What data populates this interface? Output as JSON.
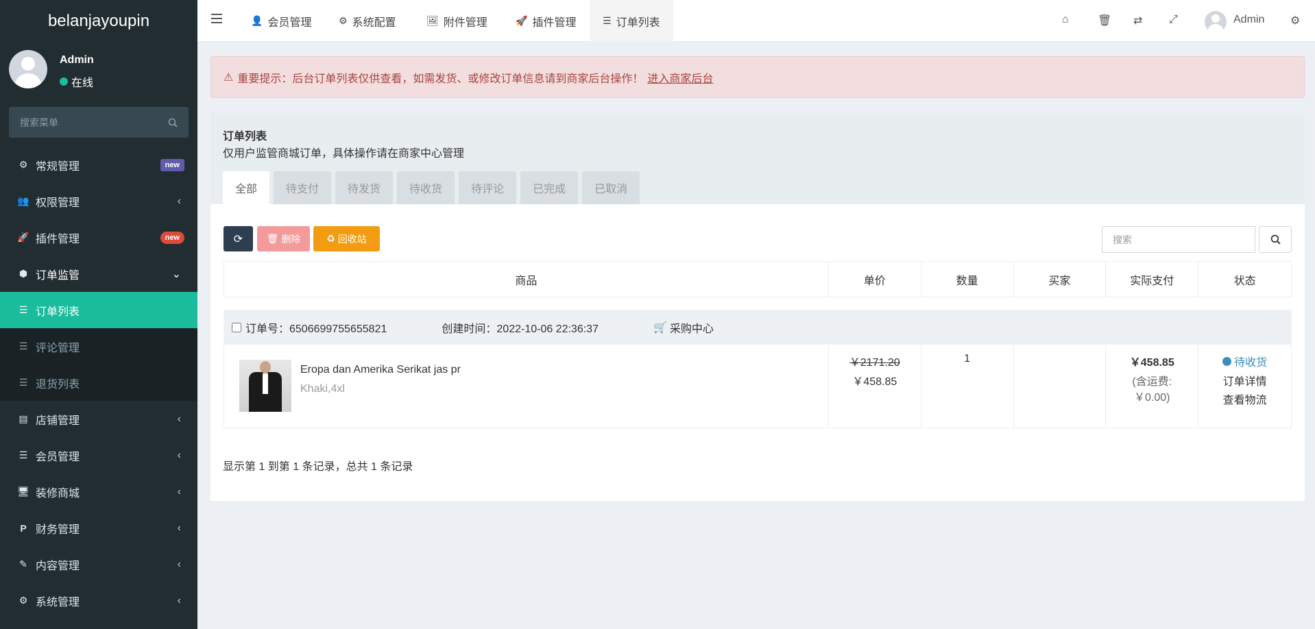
{
  "sidebar": {
    "logo": "belanjayoupin",
    "user": {
      "name": "Admin",
      "status": "在线"
    },
    "search_placeholder": "搜索菜单",
    "items": [
      {
        "label": "常规管理",
        "badge": "new"
      },
      {
        "label": "权限管理"
      },
      {
        "label": "插件管理",
        "badge": "new"
      },
      {
        "label": "订单监管"
      },
      {
        "label": "订单列表"
      },
      {
        "label": "评论管理"
      },
      {
        "label": "退货列表"
      },
      {
        "label": "店铺管理"
      },
      {
        "label": "会员管理"
      },
      {
        "label": "装修商城"
      },
      {
        "label": "财务管理"
      },
      {
        "label": "内容管理"
      },
      {
        "label": "系统管理"
      }
    ]
  },
  "topbar": {
    "tabs": [
      "会员管理",
      "系统配置",
      "附件管理",
      "插件管理",
      "订单列表"
    ],
    "admin_name": "Admin"
  },
  "alert": {
    "text": "重要提示：后台订单列表仅供查看，如需发货、或修改订单信息请到商家后台操作！",
    "link": "进入商家后台"
  },
  "panel": {
    "title": "订单列表",
    "subtitle": "仅用户监管商城订单，具体操作请在商家中心管理",
    "tabs": [
      "全部",
      "待支付",
      "待发货",
      "待收货",
      "待评论",
      "已完成",
      "已取消"
    ]
  },
  "toolbar": {
    "delete_label": "删除",
    "recycle_label": "回收站",
    "search_placeholder": "搜索"
  },
  "table": {
    "headers": [
      "商品",
      "单价",
      "数量",
      "买家",
      "实际支付",
      "状态"
    ]
  },
  "order": {
    "number_label": "订单号：6506699755655821",
    "created_label": "创建时间：2022-10-06 22:36:37",
    "source": "采购中心",
    "product_name": "Eropa dan Amerika Serikat jas pr",
    "product_spec": "Khaki,4xl",
    "price_old": "￥2171.20",
    "price_new": "￥458.85",
    "quantity": "1",
    "buyer": "",
    "paid": "￥458.85",
    "shipping_line1": "(含运费:",
    "shipping_line2": "￥0.00)",
    "status": "待收货",
    "action_detail": "订单详情",
    "action_logistics": "查看物流"
  },
  "pager": {
    "info": "显示第 1 到第 1 条记录，总共 1 条记录"
  },
  "colors": {
    "sidebar_bg": "#222d32",
    "active_menu": "#1abc9c",
    "alert_bg": "#f2dede",
    "alert_text": "#a94442",
    "btn_refresh": "#2c3e50",
    "btn_delete": "#f39a9a",
    "btn_recycle": "#f39c12",
    "status_blue": "#3c8dbc"
  }
}
